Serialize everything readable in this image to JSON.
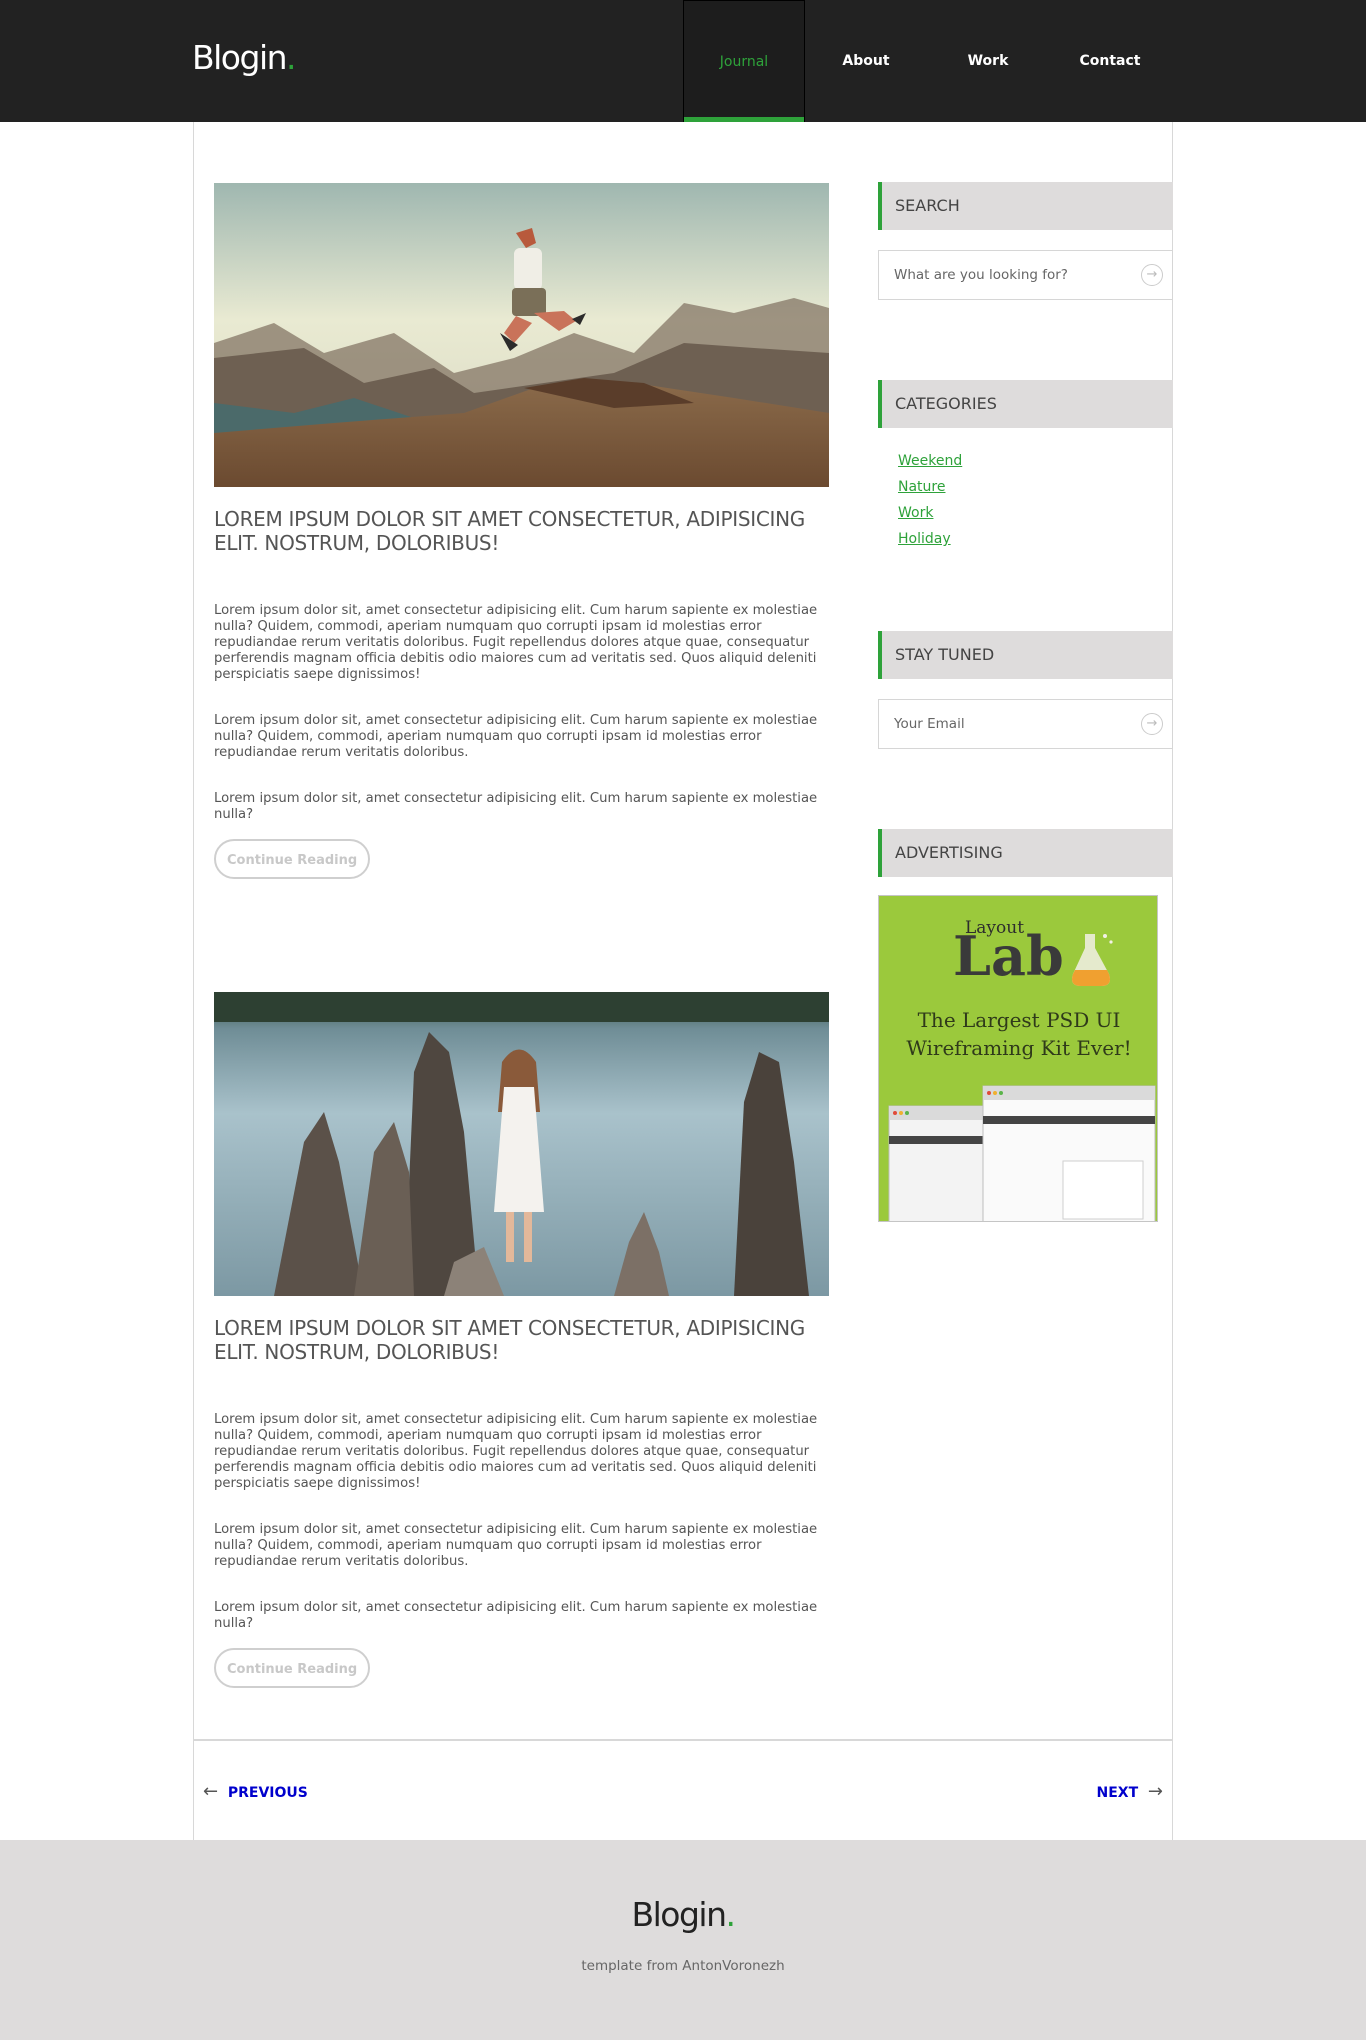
{
  "header": {
    "logo_text": "Blogin",
    "logo_dot": ".",
    "nav": [
      {
        "label": "Journal",
        "active": true
      },
      {
        "label": "About",
        "active": false
      },
      {
        "label": "Work",
        "active": false
      },
      {
        "label": "Contact",
        "active": false
      }
    ]
  },
  "posts": [
    {
      "title": "LOREM IPSUM DOLOR SIT AMET CONSECTETUR, ADIPISICING ELIT. NOSTRUM, DOLORIBUS!",
      "image": "photo of person jumping on mountain hilltop",
      "paragraphs": [
        "Lorem ipsum dolor sit, amet consectetur adipisicing elit. Cum harum sapiente ex molestiae nulla? Quidem, commodi, aperiam numquam quo corrupti ipsam id molestias error repudiandae rerum veritatis doloribus. Fugit repellendus dolores atque quae, consequatur perferendis magnam officia debitis odio maiores cum ad veritatis sed. Quos aliquid deleniti perspiciatis saepe dignissimos!",
        "Lorem ipsum dolor sit, amet consectetur adipisicing elit. Cum harum sapiente ex molestiae nulla? Quidem, commodi, aperiam numquam quo corrupti ipsam id molestias error repudiandae rerum veritatis doloribus.",
        "Lorem ipsum dolor sit, amet consectetur adipisicing elit. Cum harum sapiente ex molestiae nulla?"
      ],
      "button": "Continue Reading"
    },
    {
      "title": "LOREM IPSUM DOLOR SIT AMET CONSECTETUR, ADIPISICING ELIT. NOSTRUM, DOLORIBUS!",
      "image": "photo of woman in white dress standing in lake among tree stumps",
      "paragraphs": [
        "Lorem ipsum dolor sit, amet consectetur adipisicing elit. Cum harum sapiente ex molestiae nulla? Quidem, commodi, aperiam numquam quo corrupti ipsam id molestias error repudiandae rerum veritatis doloribus. Fugit repellendus dolores atque quae, consequatur perferendis magnam officia debitis odio maiores cum ad veritatis sed. Quos aliquid deleniti perspiciatis saepe dignissimos!",
        "Lorem ipsum dolor sit, amet consectetur adipisicing elit. Cum harum sapiente ex molestiae nulla? Quidem, commodi, aperiam numquam quo corrupti ipsam id molestias error repudiandae rerum veritatis doloribus.",
        "Lorem ipsum dolor sit, amet consectetur adipisicing elit. Cum harum sapiente ex molestiae nulla?"
      ],
      "button": "Continue Reading"
    }
  ],
  "sidebar": {
    "search": {
      "heading": "SEARCH",
      "placeholder": "What are you looking for?"
    },
    "categories": {
      "heading": "CATEGORIES",
      "items": [
        "Weekend",
        "Nature",
        "Work",
        "Holiday"
      ]
    },
    "stay_tuned": {
      "heading": "STAY TUNED",
      "placeholder": "Your Email"
    },
    "advertising": {
      "heading": "ADVERTISING",
      "ad_small": "Layout",
      "ad_big": "Lab",
      "ad_line1": "The Largest PSD UI",
      "ad_line2": "Wireframing Kit Ever!"
    }
  },
  "pagination": {
    "previous": "PREVIOUS",
    "next": "NEXT"
  },
  "footer": {
    "logo_text": "Blogin",
    "logo_dot": ".",
    "credit": "template from AntonVoronezh"
  },
  "colors": {
    "accent": "#2ea23a",
    "header_bg": "#222222",
    "footer_bg": "#dedcdc",
    "link": "#0000cc"
  }
}
